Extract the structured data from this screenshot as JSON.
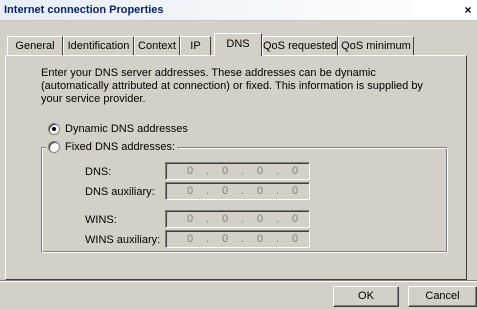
{
  "window": {
    "title": "Internet connection Properties",
    "close_glyph": "×"
  },
  "tabs": [
    {
      "label": "General"
    },
    {
      "label": "Identification"
    },
    {
      "label": "Context"
    },
    {
      "label": "IP"
    },
    {
      "label": "DNS",
      "active": true
    },
    {
      "label": "QoS requested"
    },
    {
      "label": "QoS minimum"
    }
  ],
  "dns_tab": {
    "description_lines": [
      "Enter your DNS server addresses. These addresses can be dynamic",
      "(automatically attributed at connection) or fixed. This information is supplied by",
      "your service provider."
    ],
    "dynamic_option": {
      "label": "Dynamic DNS addresses",
      "checked": true
    },
    "fixed_option": {
      "label": "Fixed DNS addresses:",
      "checked": false
    },
    "fields": [
      {
        "label": "DNS:",
        "octets": [
          "0",
          "0",
          "0",
          "0"
        ]
      },
      {
        "label": "DNS auxiliary:",
        "octets": [
          "0",
          "0",
          "0",
          "0"
        ]
      },
      {
        "label": "WINS:",
        "octets": [
          "0",
          "0",
          "0",
          "0"
        ]
      },
      {
        "label": "WINS auxiliary:",
        "octets": [
          "0",
          "0",
          "0",
          "0"
        ]
      }
    ],
    "octet_separator": "."
  },
  "buttons": {
    "ok_label": "OK",
    "cancel_label": "Cancel"
  }
}
